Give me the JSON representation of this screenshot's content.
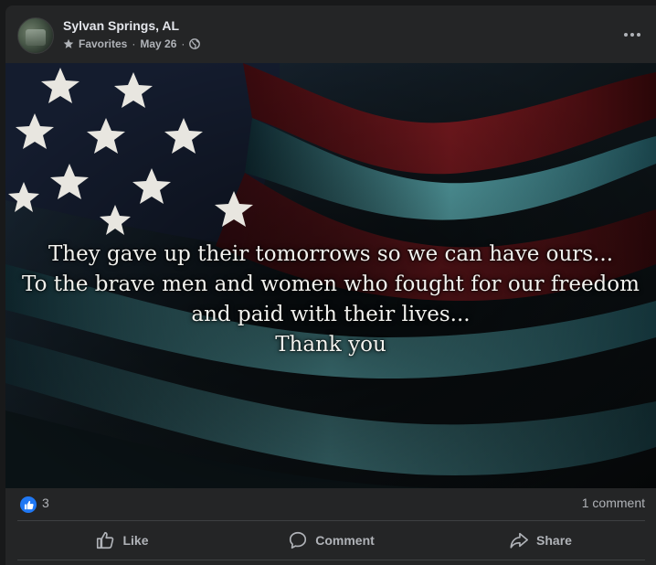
{
  "post": {
    "page_name": "Sylvan Springs, AL",
    "meta": {
      "audience_label": "Favorites",
      "separator": "·",
      "date": "May 26",
      "star_icon": "star-icon",
      "globe_icon": "globe-icon"
    },
    "more_icon": "more-options-icon"
  },
  "image": {
    "caption_lines": [
      "They gave up their tomorrows so we can have ours...",
      "To the brave men and women who fought for our freedom",
      "and paid with their lives...",
      "Thank you"
    ]
  },
  "reactions": {
    "count": "3",
    "comments": "1 comment",
    "like_color": "#2078f4"
  },
  "actions": {
    "like": "Like",
    "comment": "Comment",
    "share": "Share"
  }
}
